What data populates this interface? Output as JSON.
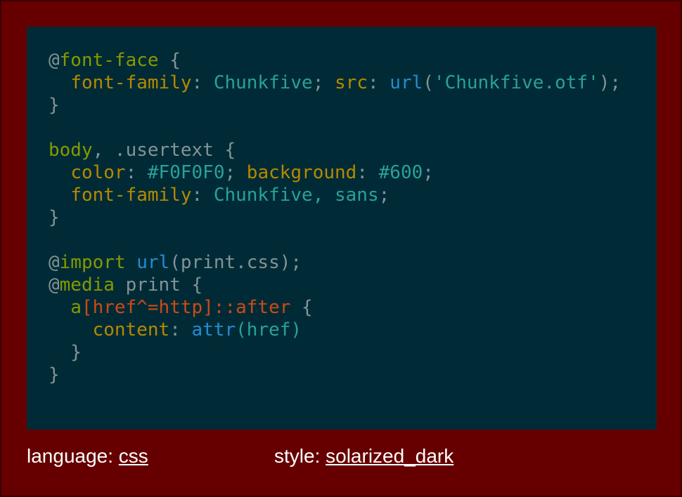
{
  "colors": {
    "page_background": "#660000",
    "code_background": "#002b36",
    "default_text": "#839496",
    "keyword": "#859900",
    "property": "#b58900",
    "string_value": "#2aa198",
    "function": "#268bd2",
    "selector_attr": "#cb4b16"
  },
  "code_lines": [
    [
      {
        "t": "@",
        "c": "default_text"
      },
      {
        "t": "font-face",
        "c": "keyword"
      },
      {
        "t": " {",
        "c": "default_text"
      }
    ],
    [
      {
        "t": "  ",
        "c": "default_text"
      },
      {
        "t": "font-family",
        "c": "property"
      },
      {
        "t": ": ",
        "c": "default_text"
      },
      {
        "t": "Chunkfive",
        "c": "string_value"
      },
      {
        "t": "; ",
        "c": "default_text"
      },
      {
        "t": "src",
        "c": "property"
      },
      {
        "t": ": ",
        "c": "default_text"
      },
      {
        "t": "url",
        "c": "function"
      },
      {
        "t": "(",
        "c": "default_text"
      },
      {
        "t": "'Chunkfive.otf'",
        "c": "string_value"
      },
      {
        "t": ");",
        "c": "default_text"
      }
    ],
    [
      {
        "t": "}",
        "c": "default_text"
      }
    ],
    [
      {
        "t": "",
        "c": "default_text"
      }
    ],
    [
      {
        "t": "body",
        "c": "keyword"
      },
      {
        "t": ", .usertext {",
        "c": "default_text"
      }
    ],
    [
      {
        "t": "  ",
        "c": "default_text"
      },
      {
        "t": "color",
        "c": "property"
      },
      {
        "t": ": ",
        "c": "default_text"
      },
      {
        "t": "#F0F0F0",
        "c": "string_value"
      },
      {
        "t": "; ",
        "c": "default_text"
      },
      {
        "t": "background",
        "c": "property"
      },
      {
        "t": ": ",
        "c": "default_text"
      },
      {
        "t": "#600",
        "c": "string_value"
      },
      {
        "t": ";",
        "c": "default_text"
      }
    ],
    [
      {
        "t": "  ",
        "c": "default_text"
      },
      {
        "t": "font-family",
        "c": "property"
      },
      {
        "t": ": ",
        "c": "default_text"
      },
      {
        "t": "Chunkfive, sans",
        "c": "string_value"
      },
      {
        "t": ";",
        "c": "default_text"
      }
    ],
    [
      {
        "t": "}",
        "c": "default_text"
      }
    ],
    [
      {
        "t": "",
        "c": "default_text"
      }
    ],
    [
      {
        "t": "@",
        "c": "default_text"
      },
      {
        "t": "import",
        "c": "keyword"
      },
      {
        "t": " ",
        "c": "default_text"
      },
      {
        "t": "url",
        "c": "function"
      },
      {
        "t": "(print.css);",
        "c": "default_text"
      }
    ],
    [
      {
        "t": "@",
        "c": "default_text"
      },
      {
        "t": "media",
        "c": "keyword"
      },
      {
        "t": " print {",
        "c": "default_text"
      }
    ],
    [
      {
        "t": "  ",
        "c": "default_text"
      },
      {
        "t": "a",
        "c": "keyword"
      },
      {
        "t": "[href^=http]::after",
        "c": "selector_attr"
      },
      {
        "t": " {",
        "c": "default_text"
      }
    ],
    [
      {
        "t": "    ",
        "c": "default_text"
      },
      {
        "t": "content",
        "c": "property"
      },
      {
        "t": ": ",
        "c": "default_text"
      },
      {
        "t": "attr",
        "c": "function"
      },
      {
        "t": "(href)",
        "c": "string_value"
      }
    ],
    [
      {
        "t": "  }",
        "c": "default_text"
      }
    ],
    [
      {
        "t": "}",
        "c": "default_text"
      }
    ]
  ],
  "footer": {
    "language_label": "language: ",
    "language_value": "css",
    "style_label": "style: ",
    "style_value": "solarized_dark"
  }
}
